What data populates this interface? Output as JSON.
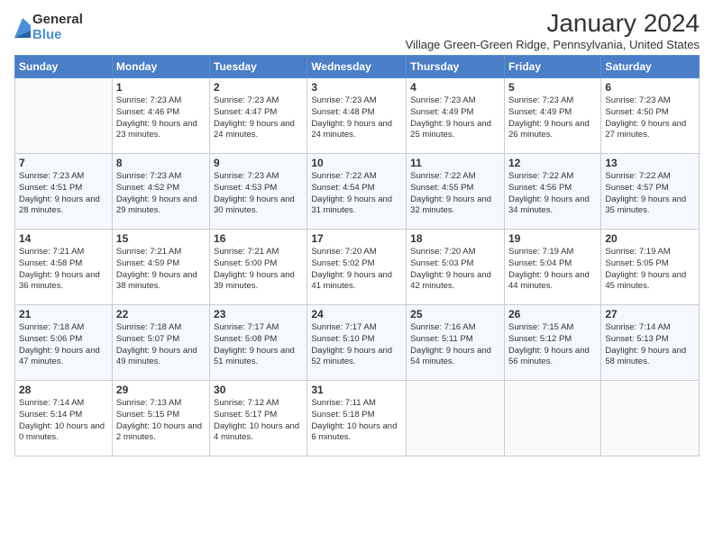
{
  "logo": {
    "general": "General",
    "blue": "Blue"
  },
  "header": {
    "title": "January 2024",
    "subtitle": "Village Green-Green Ridge, Pennsylvania, United States"
  },
  "weekdays": [
    "Sunday",
    "Monday",
    "Tuesday",
    "Wednesday",
    "Thursday",
    "Friday",
    "Saturday"
  ],
  "weeks": [
    [
      {
        "day": "",
        "sunrise": "",
        "sunset": "",
        "daylight": ""
      },
      {
        "day": "1",
        "sunrise": "Sunrise: 7:23 AM",
        "sunset": "Sunset: 4:46 PM",
        "daylight": "Daylight: 9 hours and 23 minutes."
      },
      {
        "day": "2",
        "sunrise": "Sunrise: 7:23 AM",
        "sunset": "Sunset: 4:47 PM",
        "daylight": "Daylight: 9 hours and 24 minutes."
      },
      {
        "day": "3",
        "sunrise": "Sunrise: 7:23 AM",
        "sunset": "Sunset: 4:48 PM",
        "daylight": "Daylight: 9 hours and 24 minutes."
      },
      {
        "day": "4",
        "sunrise": "Sunrise: 7:23 AM",
        "sunset": "Sunset: 4:49 PM",
        "daylight": "Daylight: 9 hours and 25 minutes."
      },
      {
        "day": "5",
        "sunrise": "Sunrise: 7:23 AM",
        "sunset": "Sunset: 4:49 PM",
        "daylight": "Daylight: 9 hours and 26 minutes."
      },
      {
        "day": "6",
        "sunrise": "Sunrise: 7:23 AM",
        "sunset": "Sunset: 4:50 PM",
        "daylight": "Daylight: 9 hours and 27 minutes."
      }
    ],
    [
      {
        "day": "7",
        "sunrise": "Sunrise: 7:23 AM",
        "sunset": "Sunset: 4:51 PM",
        "daylight": "Daylight: 9 hours and 28 minutes."
      },
      {
        "day": "8",
        "sunrise": "Sunrise: 7:23 AM",
        "sunset": "Sunset: 4:52 PM",
        "daylight": "Daylight: 9 hours and 29 minutes."
      },
      {
        "day": "9",
        "sunrise": "Sunrise: 7:23 AM",
        "sunset": "Sunset: 4:53 PM",
        "daylight": "Daylight: 9 hours and 30 minutes."
      },
      {
        "day": "10",
        "sunrise": "Sunrise: 7:22 AM",
        "sunset": "Sunset: 4:54 PM",
        "daylight": "Daylight: 9 hours and 31 minutes."
      },
      {
        "day": "11",
        "sunrise": "Sunrise: 7:22 AM",
        "sunset": "Sunset: 4:55 PM",
        "daylight": "Daylight: 9 hours and 32 minutes."
      },
      {
        "day": "12",
        "sunrise": "Sunrise: 7:22 AM",
        "sunset": "Sunset: 4:56 PM",
        "daylight": "Daylight: 9 hours and 34 minutes."
      },
      {
        "day": "13",
        "sunrise": "Sunrise: 7:22 AM",
        "sunset": "Sunset: 4:57 PM",
        "daylight": "Daylight: 9 hours and 35 minutes."
      }
    ],
    [
      {
        "day": "14",
        "sunrise": "Sunrise: 7:21 AM",
        "sunset": "Sunset: 4:58 PM",
        "daylight": "Daylight: 9 hours and 36 minutes."
      },
      {
        "day": "15",
        "sunrise": "Sunrise: 7:21 AM",
        "sunset": "Sunset: 4:59 PM",
        "daylight": "Daylight: 9 hours and 38 minutes."
      },
      {
        "day": "16",
        "sunrise": "Sunrise: 7:21 AM",
        "sunset": "Sunset: 5:00 PM",
        "daylight": "Daylight: 9 hours and 39 minutes."
      },
      {
        "day": "17",
        "sunrise": "Sunrise: 7:20 AM",
        "sunset": "Sunset: 5:02 PM",
        "daylight": "Daylight: 9 hours and 41 minutes."
      },
      {
        "day": "18",
        "sunrise": "Sunrise: 7:20 AM",
        "sunset": "Sunset: 5:03 PM",
        "daylight": "Daylight: 9 hours and 42 minutes."
      },
      {
        "day": "19",
        "sunrise": "Sunrise: 7:19 AM",
        "sunset": "Sunset: 5:04 PM",
        "daylight": "Daylight: 9 hours and 44 minutes."
      },
      {
        "day": "20",
        "sunrise": "Sunrise: 7:19 AM",
        "sunset": "Sunset: 5:05 PM",
        "daylight": "Daylight: 9 hours and 45 minutes."
      }
    ],
    [
      {
        "day": "21",
        "sunrise": "Sunrise: 7:18 AM",
        "sunset": "Sunset: 5:06 PM",
        "daylight": "Daylight: 9 hours and 47 minutes."
      },
      {
        "day": "22",
        "sunrise": "Sunrise: 7:18 AM",
        "sunset": "Sunset: 5:07 PM",
        "daylight": "Daylight: 9 hours and 49 minutes."
      },
      {
        "day": "23",
        "sunrise": "Sunrise: 7:17 AM",
        "sunset": "Sunset: 5:08 PM",
        "daylight": "Daylight: 9 hours and 51 minutes."
      },
      {
        "day": "24",
        "sunrise": "Sunrise: 7:17 AM",
        "sunset": "Sunset: 5:10 PM",
        "daylight": "Daylight: 9 hours and 52 minutes."
      },
      {
        "day": "25",
        "sunrise": "Sunrise: 7:16 AM",
        "sunset": "Sunset: 5:11 PM",
        "daylight": "Daylight: 9 hours and 54 minutes."
      },
      {
        "day": "26",
        "sunrise": "Sunrise: 7:15 AM",
        "sunset": "Sunset: 5:12 PM",
        "daylight": "Daylight: 9 hours and 56 minutes."
      },
      {
        "day": "27",
        "sunrise": "Sunrise: 7:14 AM",
        "sunset": "Sunset: 5:13 PM",
        "daylight": "Daylight: 9 hours and 58 minutes."
      }
    ],
    [
      {
        "day": "28",
        "sunrise": "Sunrise: 7:14 AM",
        "sunset": "Sunset: 5:14 PM",
        "daylight": "Daylight: 10 hours and 0 minutes."
      },
      {
        "day": "29",
        "sunrise": "Sunrise: 7:13 AM",
        "sunset": "Sunset: 5:15 PM",
        "daylight": "Daylight: 10 hours and 2 minutes."
      },
      {
        "day": "30",
        "sunrise": "Sunrise: 7:12 AM",
        "sunset": "Sunset: 5:17 PM",
        "daylight": "Daylight: 10 hours and 4 minutes."
      },
      {
        "day": "31",
        "sunrise": "Sunrise: 7:11 AM",
        "sunset": "Sunset: 5:18 PM",
        "daylight": "Daylight: 10 hours and 6 minutes."
      },
      {
        "day": "",
        "sunrise": "",
        "sunset": "",
        "daylight": ""
      },
      {
        "day": "",
        "sunrise": "",
        "sunset": "",
        "daylight": ""
      },
      {
        "day": "",
        "sunrise": "",
        "sunset": "",
        "daylight": ""
      }
    ]
  ]
}
